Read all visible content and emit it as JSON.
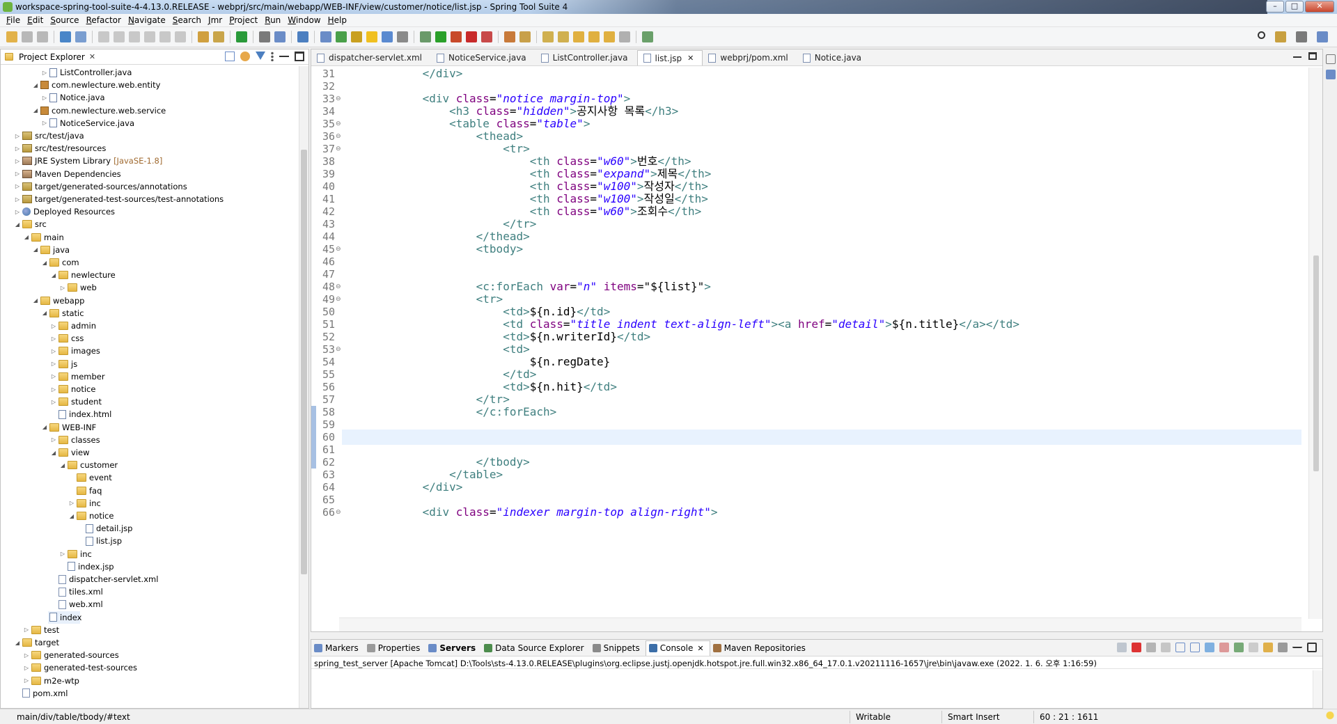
{
  "window": {
    "title": "workspace-spring-tool-suite-4-4.13.0.RELEASE - webprj/src/main/webapp/WEB-INF/view/customer/notice/list.jsp - Spring Tool Suite 4",
    "min": "–",
    "max": "□",
    "close": "✕"
  },
  "menu": [
    "File",
    "Edit",
    "Source",
    "Refactor",
    "Navigate",
    "Search",
    "Jmr",
    "Project",
    "Run",
    "Window",
    "Help"
  ],
  "explorer": {
    "title": "Project Explorer",
    "close": "✕",
    "items": [
      {
        "label": "ListController.java",
        "icon": "jfile",
        "indent": 4,
        "twisty": "▷"
      },
      {
        "label": "com.newlecture.web.entity",
        "icon": "package",
        "indent": 3,
        "twisty": "◢"
      },
      {
        "label": "Notice.java",
        "icon": "jfile",
        "indent": 4,
        "twisty": "▷"
      },
      {
        "label": "com.newlecture.web.service",
        "icon": "package",
        "indent": 3,
        "twisty": "◢"
      },
      {
        "label": "NoticeService.java",
        "icon": "jfile",
        "indent": 4,
        "twisty": "▷"
      },
      {
        "label": "src/test/java",
        "icon": "srcfolder",
        "indent": 1,
        "twisty": "▷"
      },
      {
        "label": "src/test/resources",
        "icon": "srcfolder",
        "indent": 1,
        "twisty": "▷"
      },
      {
        "label": "JRE System Library",
        "icon": "lib",
        "indent": 1,
        "twisty": "▷",
        "decor": "[JavaSE-1.8]"
      },
      {
        "label": "Maven Dependencies",
        "icon": "lib",
        "indent": 1,
        "twisty": "▷"
      },
      {
        "label": "target/generated-sources/annotations",
        "icon": "srcfolder",
        "indent": 1,
        "twisty": "▷"
      },
      {
        "label": "target/generated-test-sources/test-annotations",
        "icon": "srcfolder",
        "indent": 1,
        "twisty": "▷"
      },
      {
        "label": "Deployed Resources",
        "icon": "globe",
        "indent": 1,
        "twisty": "▷"
      },
      {
        "label": "src",
        "icon": "folder",
        "indent": 1,
        "twisty": "◢"
      },
      {
        "label": "main",
        "icon": "folder",
        "indent": 2,
        "twisty": "◢"
      },
      {
        "label": "java",
        "icon": "folder",
        "indent": 3,
        "twisty": "◢"
      },
      {
        "label": "com",
        "icon": "folder",
        "indent": 4,
        "twisty": "◢"
      },
      {
        "label": "newlecture",
        "icon": "folder",
        "indent": 5,
        "twisty": "◢"
      },
      {
        "label": "web",
        "icon": "folder",
        "indent": 6,
        "twisty": "▷"
      },
      {
        "label": "webapp",
        "icon": "folder",
        "indent": 3,
        "twisty": "◢"
      },
      {
        "label": "static",
        "icon": "folder",
        "indent": 4,
        "twisty": "◢"
      },
      {
        "label": "admin",
        "icon": "folder",
        "indent": 5,
        "twisty": "▷"
      },
      {
        "label": "css",
        "icon": "folder",
        "indent": 5,
        "twisty": "▷"
      },
      {
        "label": "images",
        "icon": "folder",
        "indent": 5,
        "twisty": "▷"
      },
      {
        "label": "js",
        "icon": "folder",
        "indent": 5,
        "twisty": "▷"
      },
      {
        "label": "member",
        "icon": "folder",
        "indent": 5,
        "twisty": "▷"
      },
      {
        "label": "notice",
        "icon": "folder",
        "indent": 5,
        "twisty": "▷"
      },
      {
        "label": "student",
        "icon": "folder",
        "indent": 5,
        "twisty": "▷"
      },
      {
        "label": "index.html",
        "icon": "html",
        "indent": 5,
        "twisty": ""
      },
      {
        "label": "WEB-INF",
        "icon": "folder",
        "indent": 4,
        "twisty": "◢"
      },
      {
        "label": "classes",
        "icon": "folder",
        "indent": 5,
        "twisty": "▷"
      },
      {
        "label": "view",
        "icon": "folder",
        "indent": 5,
        "twisty": "◢"
      },
      {
        "label": "customer",
        "icon": "folder",
        "indent": 6,
        "twisty": "◢"
      },
      {
        "label": "event",
        "icon": "folder",
        "indent": 7,
        "twisty": ""
      },
      {
        "label": "faq",
        "icon": "folder",
        "indent": 7,
        "twisty": ""
      },
      {
        "label": "inc",
        "icon": "folder",
        "indent": 7,
        "twisty": "▷"
      },
      {
        "label": "notice",
        "icon": "folder",
        "indent": 7,
        "twisty": "◢"
      },
      {
        "label": "detail.jsp",
        "icon": "jsp",
        "indent": 8,
        "twisty": ""
      },
      {
        "label": "list.jsp",
        "icon": "jsp",
        "indent": 8,
        "twisty": ""
      },
      {
        "label": "inc",
        "icon": "folder",
        "indent": 6,
        "twisty": "▷"
      },
      {
        "label": "index.jsp",
        "icon": "jsp",
        "indent": 6,
        "twisty": ""
      },
      {
        "label": "dispatcher-servlet.xml",
        "icon": "xfile",
        "indent": 5,
        "twisty": ""
      },
      {
        "label": "tiles.xml",
        "icon": "xfile",
        "indent": 5,
        "twisty": ""
      },
      {
        "label": "web.xml",
        "icon": "xfile",
        "indent": 5,
        "twisty": ""
      },
      {
        "label": "index",
        "icon": "jsp",
        "indent": 4,
        "twisty": "",
        "selected": true
      },
      {
        "label": "test",
        "icon": "folder",
        "indent": 2,
        "twisty": "▷"
      },
      {
        "label": "target",
        "icon": "folder",
        "indent": 1,
        "twisty": "◢"
      },
      {
        "label": "generated-sources",
        "icon": "folder",
        "indent": 2,
        "twisty": "▷"
      },
      {
        "label": "generated-test-sources",
        "icon": "folder",
        "indent": 2,
        "twisty": "▷"
      },
      {
        "label": "m2e-wtp",
        "icon": "folder",
        "indent": 2,
        "twisty": "▷"
      },
      {
        "label": "pom.xml",
        "icon": "xfile",
        "indent": 1,
        "twisty": ""
      }
    ]
  },
  "editor": {
    "tabs": [
      {
        "label": "dispatcher-servlet.xml",
        "active": false
      },
      {
        "label": "NoticeService.java",
        "active": false
      },
      {
        "label": "ListController.java",
        "active": false
      },
      {
        "label": "list.jsp",
        "active": true
      },
      {
        "label": "webprj/pom.xml",
        "active": false
      },
      {
        "label": "Notice.java",
        "active": false
      }
    ],
    "first_line": 31,
    "current_line": 60,
    "fold_lines": [
      33,
      35,
      36,
      37,
      45,
      48,
      49,
      53,
      66
    ],
    "changed_lines": [
      58,
      59,
      60,
      61,
      62
    ],
    "lines": [
      [
        [
          "",
          "            "
        ],
        [
          "tag",
          "</div>"
        ]
      ],
      [],
      [
        [
          "",
          "            "
        ],
        [
          "tag",
          "<div "
        ],
        [
          "attr",
          "class"
        ],
        [
          "txt",
          "="
        ],
        [
          "val",
          "\"notice margin-top\""
        ],
        [
          "tag",
          ">"
        ]
      ],
      [
        [
          "",
          "                "
        ],
        [
          "tag",
          "<h3 "
        ],
        [
          "attr",
          "class"
        ],
        [
          "txt",
          "="
        ],
        [
          "val",
          "\"hidden\""
        ],
        [
          "tag",
          ">"
        ],
        [
          "txt",
          "공지사항 목록"
        ],
        [
          "tag",
          "</h3>"
        ]
      ],
      [
        [
          "",
          "                "
        ],
        [
          "tag",
          "<table "
        ],
        [
          "attr",
          "class"
        ],
        [
          "txt",
          "="
        ],
        [
          "val",
          "\"table\""
        ],
        [
          "tag",
          ">"
        ]
      ],
      [
        [
          "",
          "                    "
        ],
        [
          "tag",
          "<thead>"
        ]
      ],
      [
        [
          "",
          "                        "
        ],
        [
          "tag",
          "<tr>"
        ]
      ],
      [
        [
          "",
          "                            "
        ],
        [
          "tag",
          "<th "
        ],
        [
          "attr",
          "class"
        ],
        [
          "txt",
          "="
        ],
        [
          "val",
          "\"w60\""
        ],
        [
          "tag",
          ">"
        ],
        [
          "txt",
          "번호"
        ],
        [
          "tag",
          "</th>"
        ]
      ],
      [
        [
          "",
          "                            "
        ],
        [
          "tag",
          "<th "
        ],
        [
          "attr",
          "class"
        ],
        [
          "txt",
          "="
        ],
        [
          "val",
          "\"expand\""
        ],
        [
          "tag",
          ">"
        ],
        [
          "txt",
          "제목"
        ],
        [
          "tag",
          "</th>"
        ]
      ],
      [
        [
          "",
          "                            "
        ],
        [
          "tag",
          "<th "
        ],
        [
          "attr",
          "class"
        ],
        [
          "txt",
          "="
        ],
        [
          "val",
          "\"w100\""
        ],
        [
          "tag",
          ">"
        ],
        [
          "txt",
          "작성자"
        ],
        [
          "tag",
          "</th>"
        ]
      ],
      [
        [
          "",
          "                            "
        ],
        [
          "tag",
          "<th "
        ],
        [
          "attr",
          "class"
        ],
        [
          "txt",
          "="
        ],
        [
          "val",
          "\"w100\""
        ],
        [
          "tag",
          ">"
        ],
        [
          "txt",
          "작성일"
        ],
        [
          "tag",
          "</th>"
        ]
      ],
      [
        [
          "",
          "                            "
        ],
        [
          "tag",
          "<th "
        ],
        [
          "attr",
          "class"
        ],
        [
          "txt",
          "="
        ],
        [
          "val",
          "\"w60\""
        ],
        [
          "tag",
          ">"
        ],
        [
          "txt",
          "조회수"
        ],
        [
          "tag",
          "</th>"
        ]
      ],
      [
        [
          "",
          "                        "
        ],
        [
          "tag",
          "</tr>"
        ]
      ],
      [
        [
          "",
          "                    "
        ],
        [
          "tag",
          "</thead>"
        ]
      ],
      [
        [
          "",
          "                    "
        ],
        [
          "tag",
          "<tbody>"
        ]
      ],
      [],
      [],
      [
        [
          "",
          "                    "
        ],
        [
          "tag",
          "<c:forEach "
        ],
        [
          "attr",
          "var"
        ],
        [
          "txt",
          "="
        ],
        [
          "val",
          "\"n\""
        ],
        [
          "txt",
          " "
        ],
        [
          "attr",
          "items"
        ],
        [
          "txt",
          "=\"${list}\""
        ],
        [
          "tag",
          ">"
        ]
      ],
      [
        [
          "",
          "                    "
        ],
        [
          "tag",
          "<tr>"
        ]
      ],
      [
        [
          "",
          "                        "
        ],
        [
          "tag",
          "<td>"
        ],
        [
          "txt",
          "${n.id}"
        ],
        [
          "tag",
          "</td>"
        ]
      ],
      [
        [
          "",
          "                        "
        ],
        [
          "tag",
          "<td "
        ],
        [
          "attr",
          "class"
        ],
        [
          "txt",
          "="
        ],
        [
          "val",
          "\"title indent text-align-left\""
        ],
        [
          "tag",
          "><a "
        ],
        [
          "attr",
          "href"
        ],
        [
          "txt",
          "="
        ],
        [
          "val",
          "\"detail\""
        ],
        [
          "tag",
          ">"
        ],
        [
          "txt",
          "${n.title}"
        ],
        [
          "tag",
          "</a></td>"
        ]
      ],
      [
        [
          "",
          "                        "
        ],
        [
          "tag",
          "<td>"
        ],
        [
          "txt",
          "${n.writerId}"
        ],
        [
          "tag",
          "</td>"
        ]
      ],
      [
        [
          "",
          "                        "
        ],
        [
          "tag",
          "<td>"
        ]
      ],
      [
        [
          "",
          "                            "
        ],
        [
          "txt",
          "${n.regDate}"
        ]
      ],
      [
        [
          "",
          "                        "
        ],
        [
          "tag",
          "</td>"
        ]
      ],
      [
        [
          "",
          "                        "
        ],
        [
          "tag",
          "<td>"
        ],
        [
          "txt",
          "${n.hit}"
        ],
        [
          "tag",
          "</td>"
        ]
      ],
      [
        [
          "",
          "                    "
        ],
        [
          "tag",
          "</tr>"
        ]
      ],
      [
        [
          "",
          "                    "
        ],
        [
          "tag",
          "</c:forEach>"
        ]
      ],
      [],
      [],
      [],
      [
        [
          "",
          "                    "
        ],
        [
          "tag",
          "</tbody>"
        ]
      ],
      [
        [
          "",
          "                "
        ],
        [
          "tag",
          "</table>"
        ]
      ],
      [
        [
          "",
          "            "
        ],
        [
          "tag",
          "</div>"
        ]
      ],
      [],
      [
        [
          "",
          "            "
        ],
        [
          "tag",
          "<div "
        ],
        [
          "attr",
          "class"
        ],
        [
          "txt",
          "="
        ],
        [
          "val",
          "\"indexer margin-top align-right\""
        ],
        [
          "tag",
          ">"
        ]
      ]
    ]
  },
  "bottom": {
    "tabs": [
      {
        "label": "Markers",
        "icon_color": "#6a8cc7"
      },
      {
        "label": "Properties",
        "icon_color": "#9a9a9a"
      },
      {
        "label": "Servers",
        "icon_color": "#6a8cc7",
        "bold": true
      },
      {
        "label": "Data Source Explorer",
        "icon_color": "#4c8c4c"
      },
      {
        "label": "Snippets",
        "icon_color": "#8a8a8a"
      },
      {
        "label": "Console",
        "icon_color": "#3c6ea8",
        "active": true
      },
      {
        "label": "Maven Repositories",
        "icon_color": "#a07040"
      }
    ],
    "console_header": "spring_test_server [Apache Tomcat] D:\\Tools\\sts-4.13.0.RELEASE\\plugins\\org.eclipse.justj.openjdk.hotspot.jre.full.win32.x86_64_17.0.1.v20211116-1657\\jre\\bin\\javaw.exe  (2022. 1. 6. 오후 1:16:59)"
  },
  "status": {
    "path": "main/div/table/tbody/#text",
    "writable": "Writable",
    "insert_mode": "Smart Insert",
    "position": "60 : 21 : 1611"
  },
  "colors": {
    "tag": "#3f7f7f",
    "attr": "#7f007f",
    "value": "#2a00ff",
    "current_line": "#e8f2fe",
    "change_bar": "#a7c0e3"
  }
}
